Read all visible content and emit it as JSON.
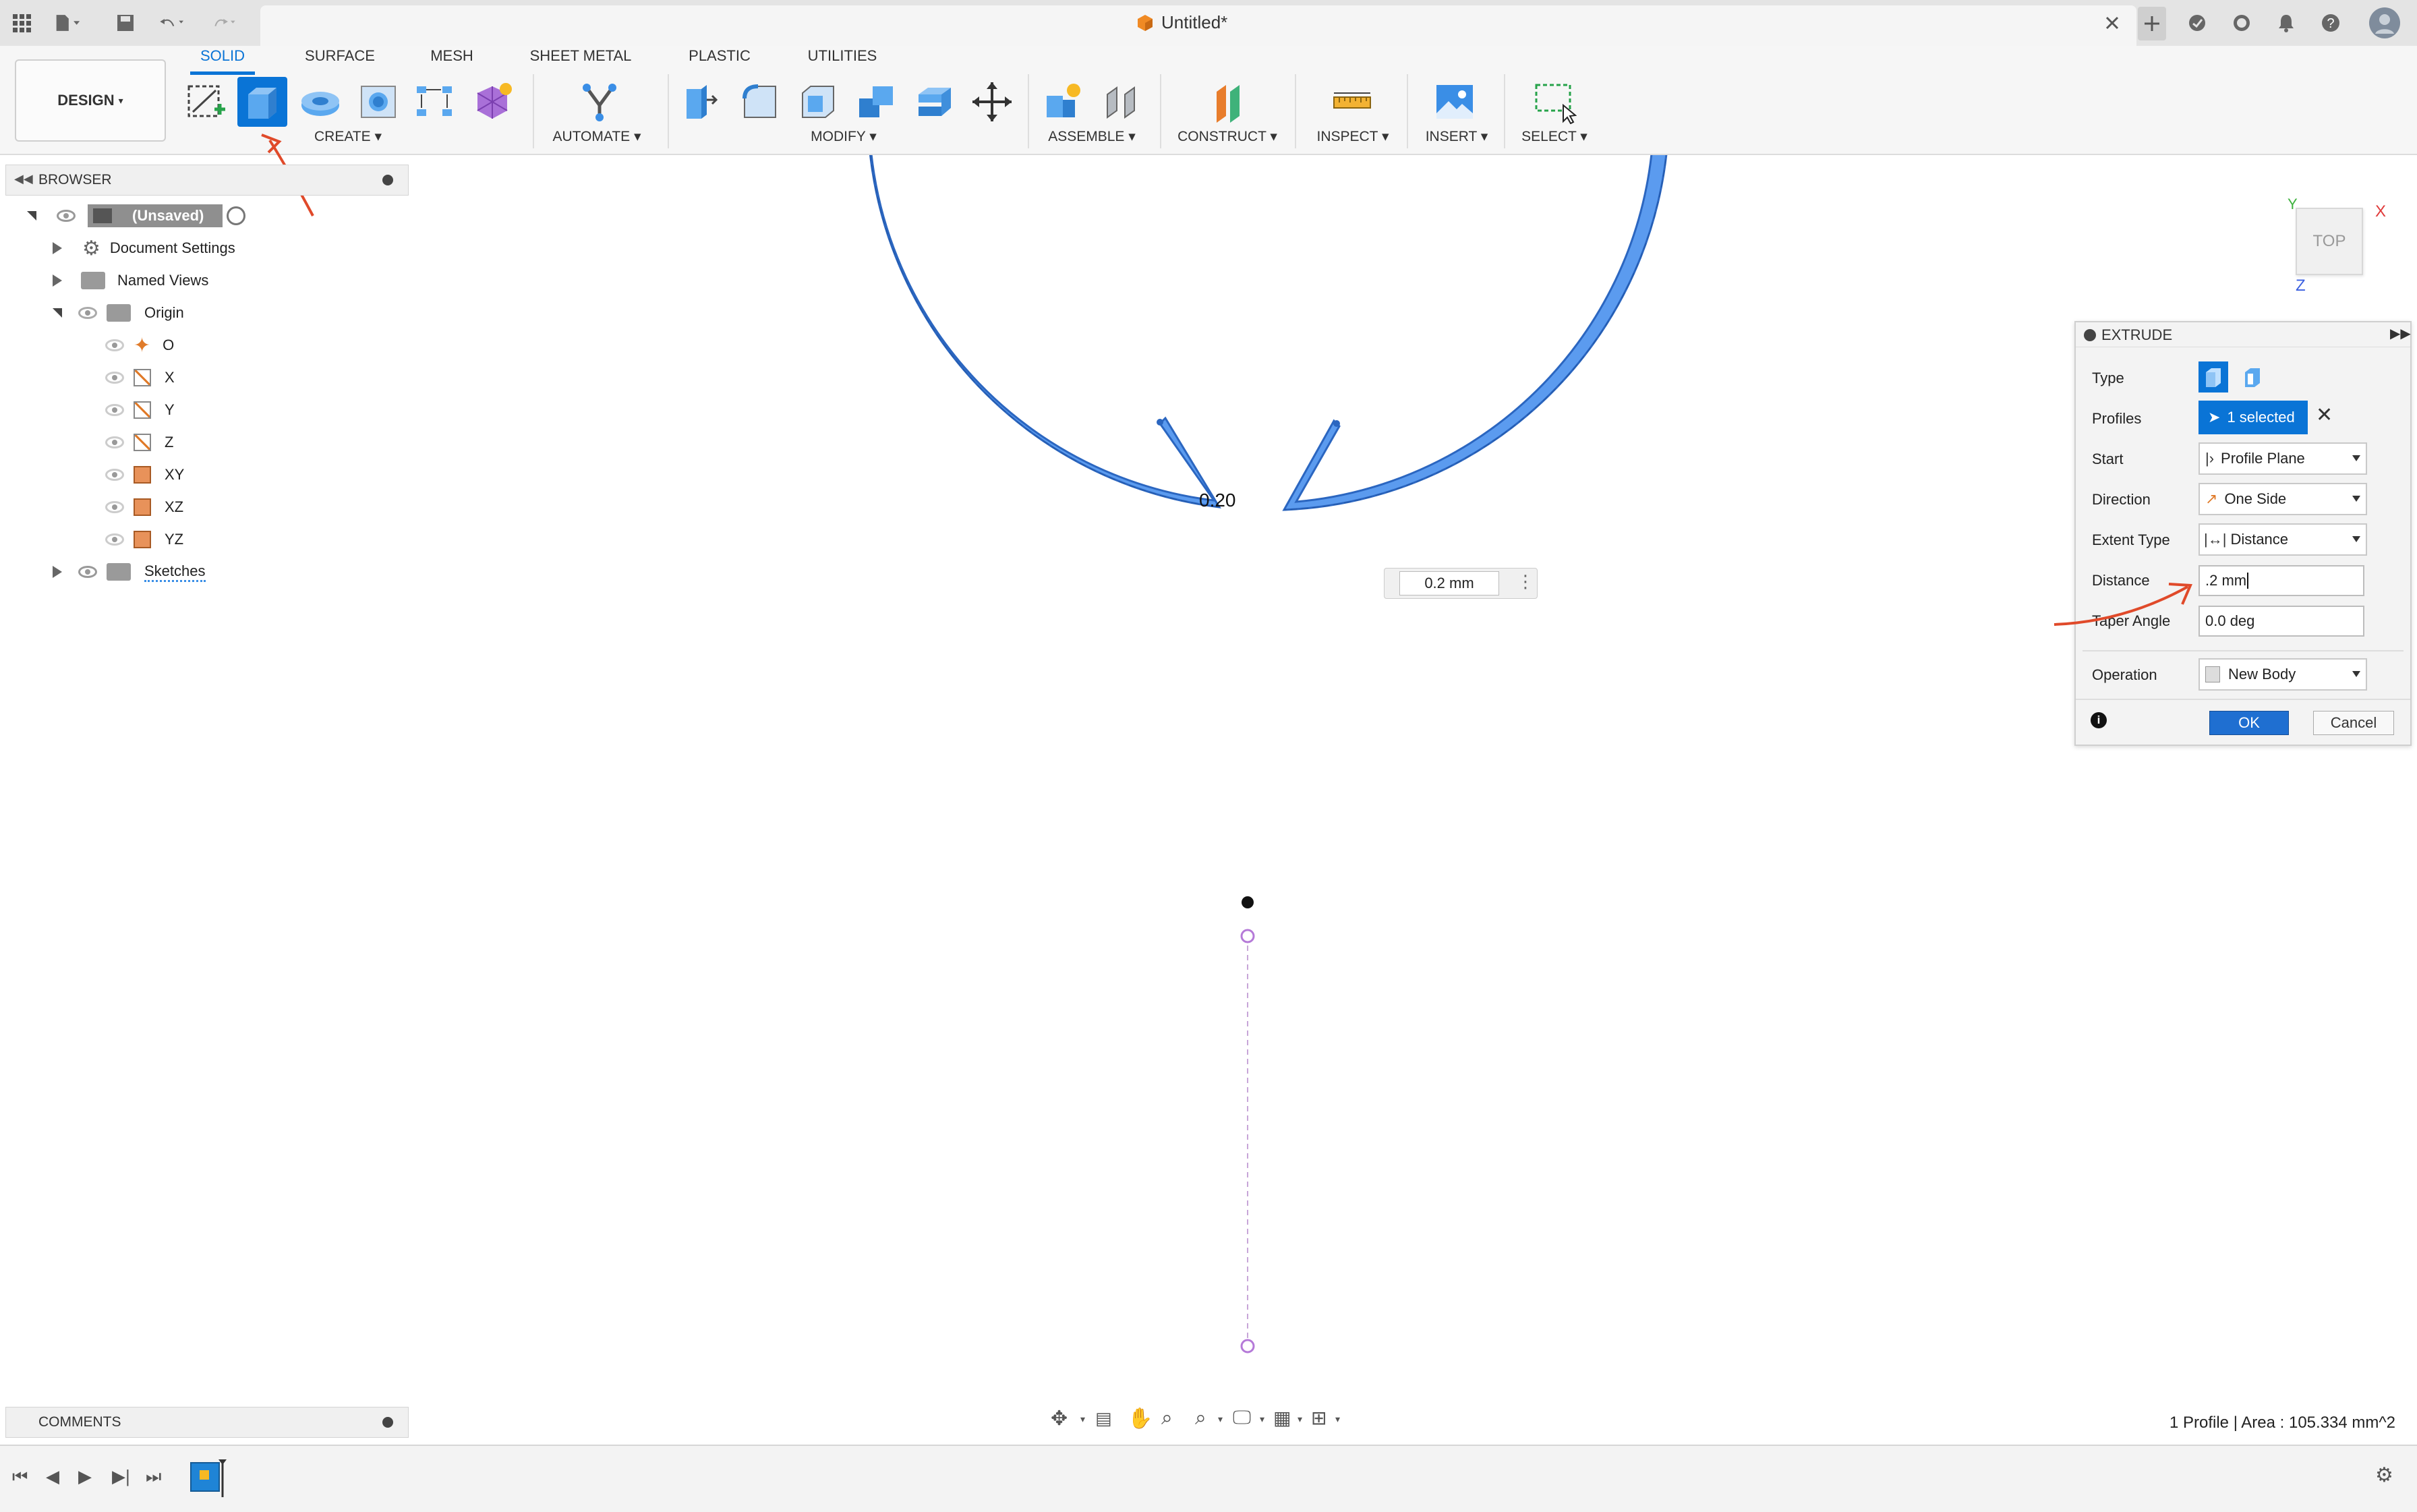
{
  "window": {
    "title": "Untitled*"
  },
  "workspace": {
    "label": "DESIGN",
    "label_suffix": "▾"
  },
  "tabs": [
    {
      "label": "SOLID",
      "active": true
    },
    {
      "label": "SURFACE"
    },
    {
      "label": "MESH"
    },
    {
      "label": "SHEET METAL"
    },
    {
      "label": "PLASTIC"
    },
    {
      "label": "UTILITIES"
    }
  ],
  "groups": {
    "create": "CREATE ▾",
    "automate": "AUTOMATE ▾",
    "modify": "MODIFY ▾",
    "assemble": "ASSEMBLE ▾",
    "construct": "CONSTRUCT ▾",
    "inspect": "INSPECT ▾",
    "insert": "INSERT ▾",
    "select": "SELECT ▾"
  },
  "browser": {
    "header": "BROWSER",
    "root": "(Unsaved)",
    "items": {
      "doc_settings": "Document Settings",
      "named_views": "Named Views",
      "origin": "Origin",
      "o": "O",
      "x": "X",
      "y": "Y",
      "z": "Z",
      "xy": "XY",
      "xz": "XZ",
      "yz": "YZ",
      "sketches": "Sketches"
    }
  },
  "comments": {
    "header": "COMMENTS"
  },
  "viewcube": {
    "face": "TOP",
    "axis_x": "X",
    "axis_y": "Y",
    "axis_z": "Z"
  },
  "canvas": {
    "dimension_label": "0.20",
    "distance_input": "0.2 mm"
  },
  "extrude": {
    "title": "EXTRUDE",
    "type_label": "Type",
    "profiles_label": "Profiles",
    "profiles_value": "1 selected",
    "start_label": "Start",
    "start_value": "Profile Plane",
    "direction_label": "Direction",
    "direction_value": "One Side",
    "extent_label": "Extent Type",
    "extent_value": "Distance",
    "distance_label": "Distance",
    "distance_value": ".2 mm",
    "taper_label": "Taper Angle",
    "taper_value": "0.0 deg",
    "operation_label": "Operation",
    "operation_value": "New Body",
    "ok": "OK",
    "cancel": "Cancel"
  },
  "status": {
    "text": "1 Profile | Area : 105.334 mm^2"
  },
  "colors": {
    "accent": "#0a74d6",
    "profile_fill": "#5b9bef",
    "annotation": "#e04a2a"
  }
}
